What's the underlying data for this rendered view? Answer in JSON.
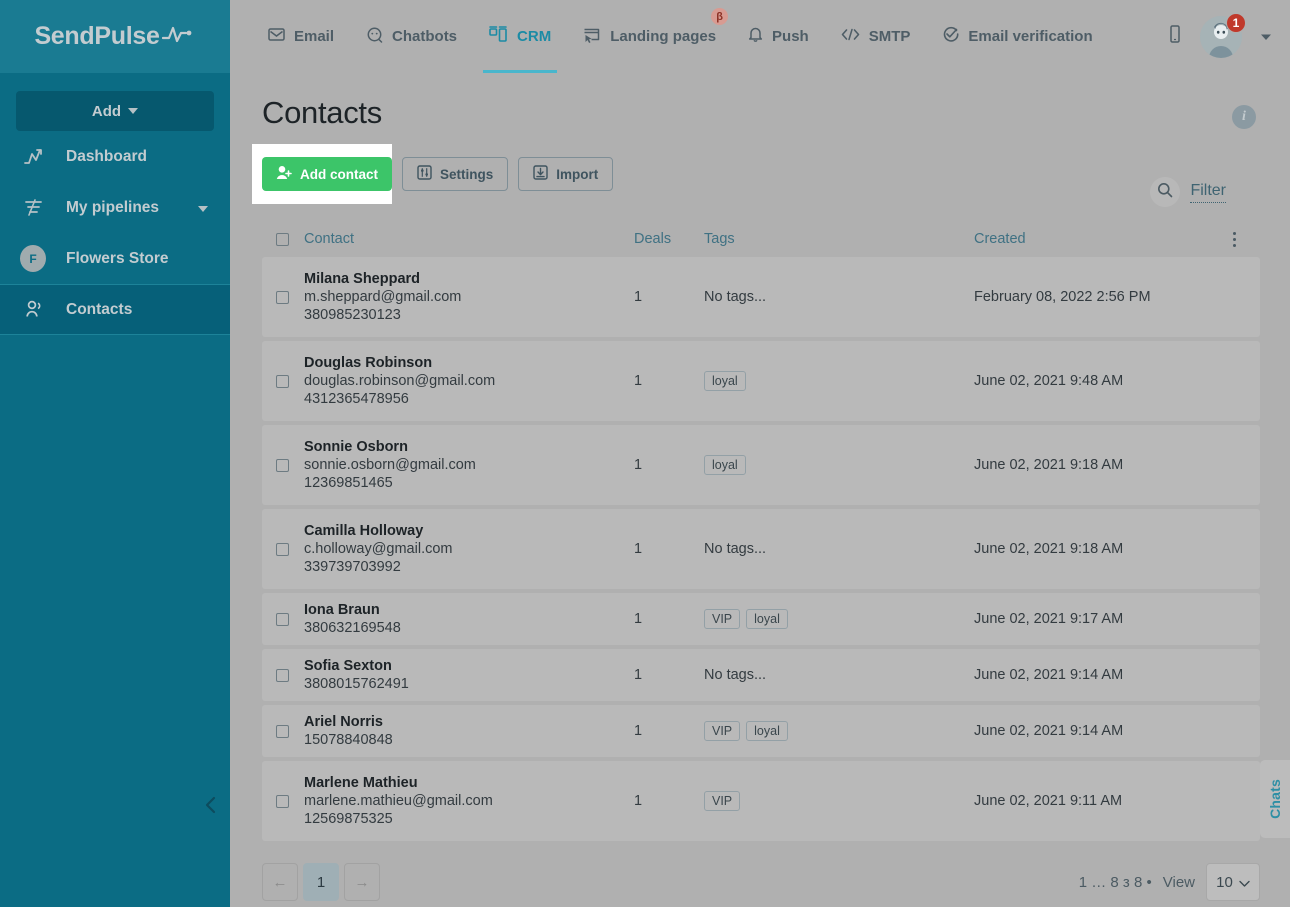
{
  "brand": {
    "name": "SendPulse",
    "logo_icon": "pulse-wave-icon"
  },
  "sidebar": {
    "add_button": {
      "label": "Add",
      "icon": "caret-down-icon"
    },
    "items": [
      {
        "label": "Dashboard",
        "icon": "chart-line-icon",
        "active": false,
        "has_caret": false
      },
      {
        "label": "My pipelines",
        "icon": "funnel-icon",
        "active": false,
        "has_caret": true
      },
      {
        "label": "Flowers Store",
        "icon": "avatar-letter-icon",
        "avatar_letter": "F",
        "active": false,
        "has_caret": false
      },
      {
        "label": "Contacts",
        "icon": "users-icon",
        "active": true,
        "has_caret": false
      }
    ],
    "collapse_icon": "chevron-left-icon",
    "bg_color": "#0b6c84",
    "active_color": "#066079"
  },
  "topnav": {
    "items": [
      {
        "label": "Email",
        "icon": "envelope-icon",
        "active": false,
        "badge": ""
      },
      {
        "label": "Chatbots",
        "icon": "chat-bubble-icon",
        "active": false,
        "badge": ""
      },
      {
        "label": "CRM",
        "icon": "crm-columns-icon",
        "active": true,
        "badge": ""
      },
      {
        "label": "Landing pages",
        "icon": "landing-page-icon",
        "active": false,
        "badge": "β"
      },
      {
        "label": "Push",
        "icon": "bell-icon",
        "active": false,
        "badge": ""
      },
      {
        "label": "SMTP",
        "icon": "code-brackets-icon",
        "active": false,
        "badge": ""
      },
      {
        "label": "Email verification",
        "icon": "check-circle-icon",
        "active": false,
        "badge": ""
      }
    ],
    "mobile_icon": "mobile-device-icon",
    "avatar_icon": "user-avatar-icon",
    "notification_count": "1",
    "profile_caret_icon": "caret-down-icon",
    "active_color": "#1b8ba5",
    "beta_badge_color": "#d89b92"
  },
  "page": {
    "title": "Contacts",
    "info_icon": "info-circle-icon"
  },
  "toolbar": {
    "add_contact_label": "Add contact",
    "add_contact_icon": "user-plus-icon",
    "settings_label": "Settings",
    "settings_icon": "sliders-icon",
    "import_label": "Import",
    "import_icon": "import-download-icon",
    "primary_color": "#3cc569",
    "search_icon": "search-icon",
    "filter_label": "Filter"
  },
  "table": {
    "headers": {
      "contact": "Contact",
      "deals": "Deals",
      "tags": "Tags",
      "created": "Created"
    },
    "menu_icon": "kebab-menu-icon",
    "no_tags_text": "No tags...",
    "rows": [
      {
        "name": "Milana Sheppard",
        "email": "m.sheppard@gmail.com",
        "phone": "380985230123",
        "deals": "1",
        "tags": [],
        "created": "February 08, 2022 2:56 PM"
      },
      {
        "name": "Douglas Robinson",
        "email": "douglas.robinson@gmail.com",
        "phone": "4312365478956",
        "deals": "1",
        "tags": [
          "loyal"
        ],
        "created": "June 02, 2021 9:48 AM"
      },
      {
        "name": "Sonnie Osborn",
        "email": "sonnie.osborn@gmail.com",
        "phone": "12369851465",
        "deals": "1",
        "tags": [
          "loyal"
        ],
        "created": "June 02, 2021 9:18 AM"
      },
      {
        "name": "Camilla Holloway",
        "email": "c.holloway@gmail.com",
        "phone": "339739703992",
        "deals": "1",
        "tags": [],
        "created": "June 02, 2021 9:18 AM"
      },
      {
        "name": "Iona Braun",
        "email": "",
        "phone": "380632169548",
        "deals": "1",
        "tags": [
          "VIP",
          "loyal"
        ],
        "created": "June 02, 2021 9:17 AM"
      },
      {
        "name": "Sofia Sexton",
        "email": "",
        "phone": "3808015762491",
        "deals": "1",
        "tags": [],
        "created": "June 02, 2021 9:14 AM"
      },
      {
        "name": "Ariel Norris",
        "email": "",
        "phone": "15078840848",
        "deals": "1",
        "tags": [
          "VIP",
          "loyal"
        ],
        "created": "June 02, 2021 9:14 AM"
      },
      {
        "name": "Marlene Mathieu",
        "email": "marlene.mathieu@gmail.com",
        "phone": "12569875325",
        "deals": "1",
        "tags": [
          "VIP"
        ],
        "created": "June 02, 2021 9:11 AM"
      }
    ]
  },
  "footer": {
    "prev_label": "←",
    "page_label": "1",
    "next_label": "→",
    "count_text": "1 … 8 з 8 •",
    "view_label": "View",
    "page_size": "10"
  },
  "chats_tab": {
    "label": "Chats"
  }
}
